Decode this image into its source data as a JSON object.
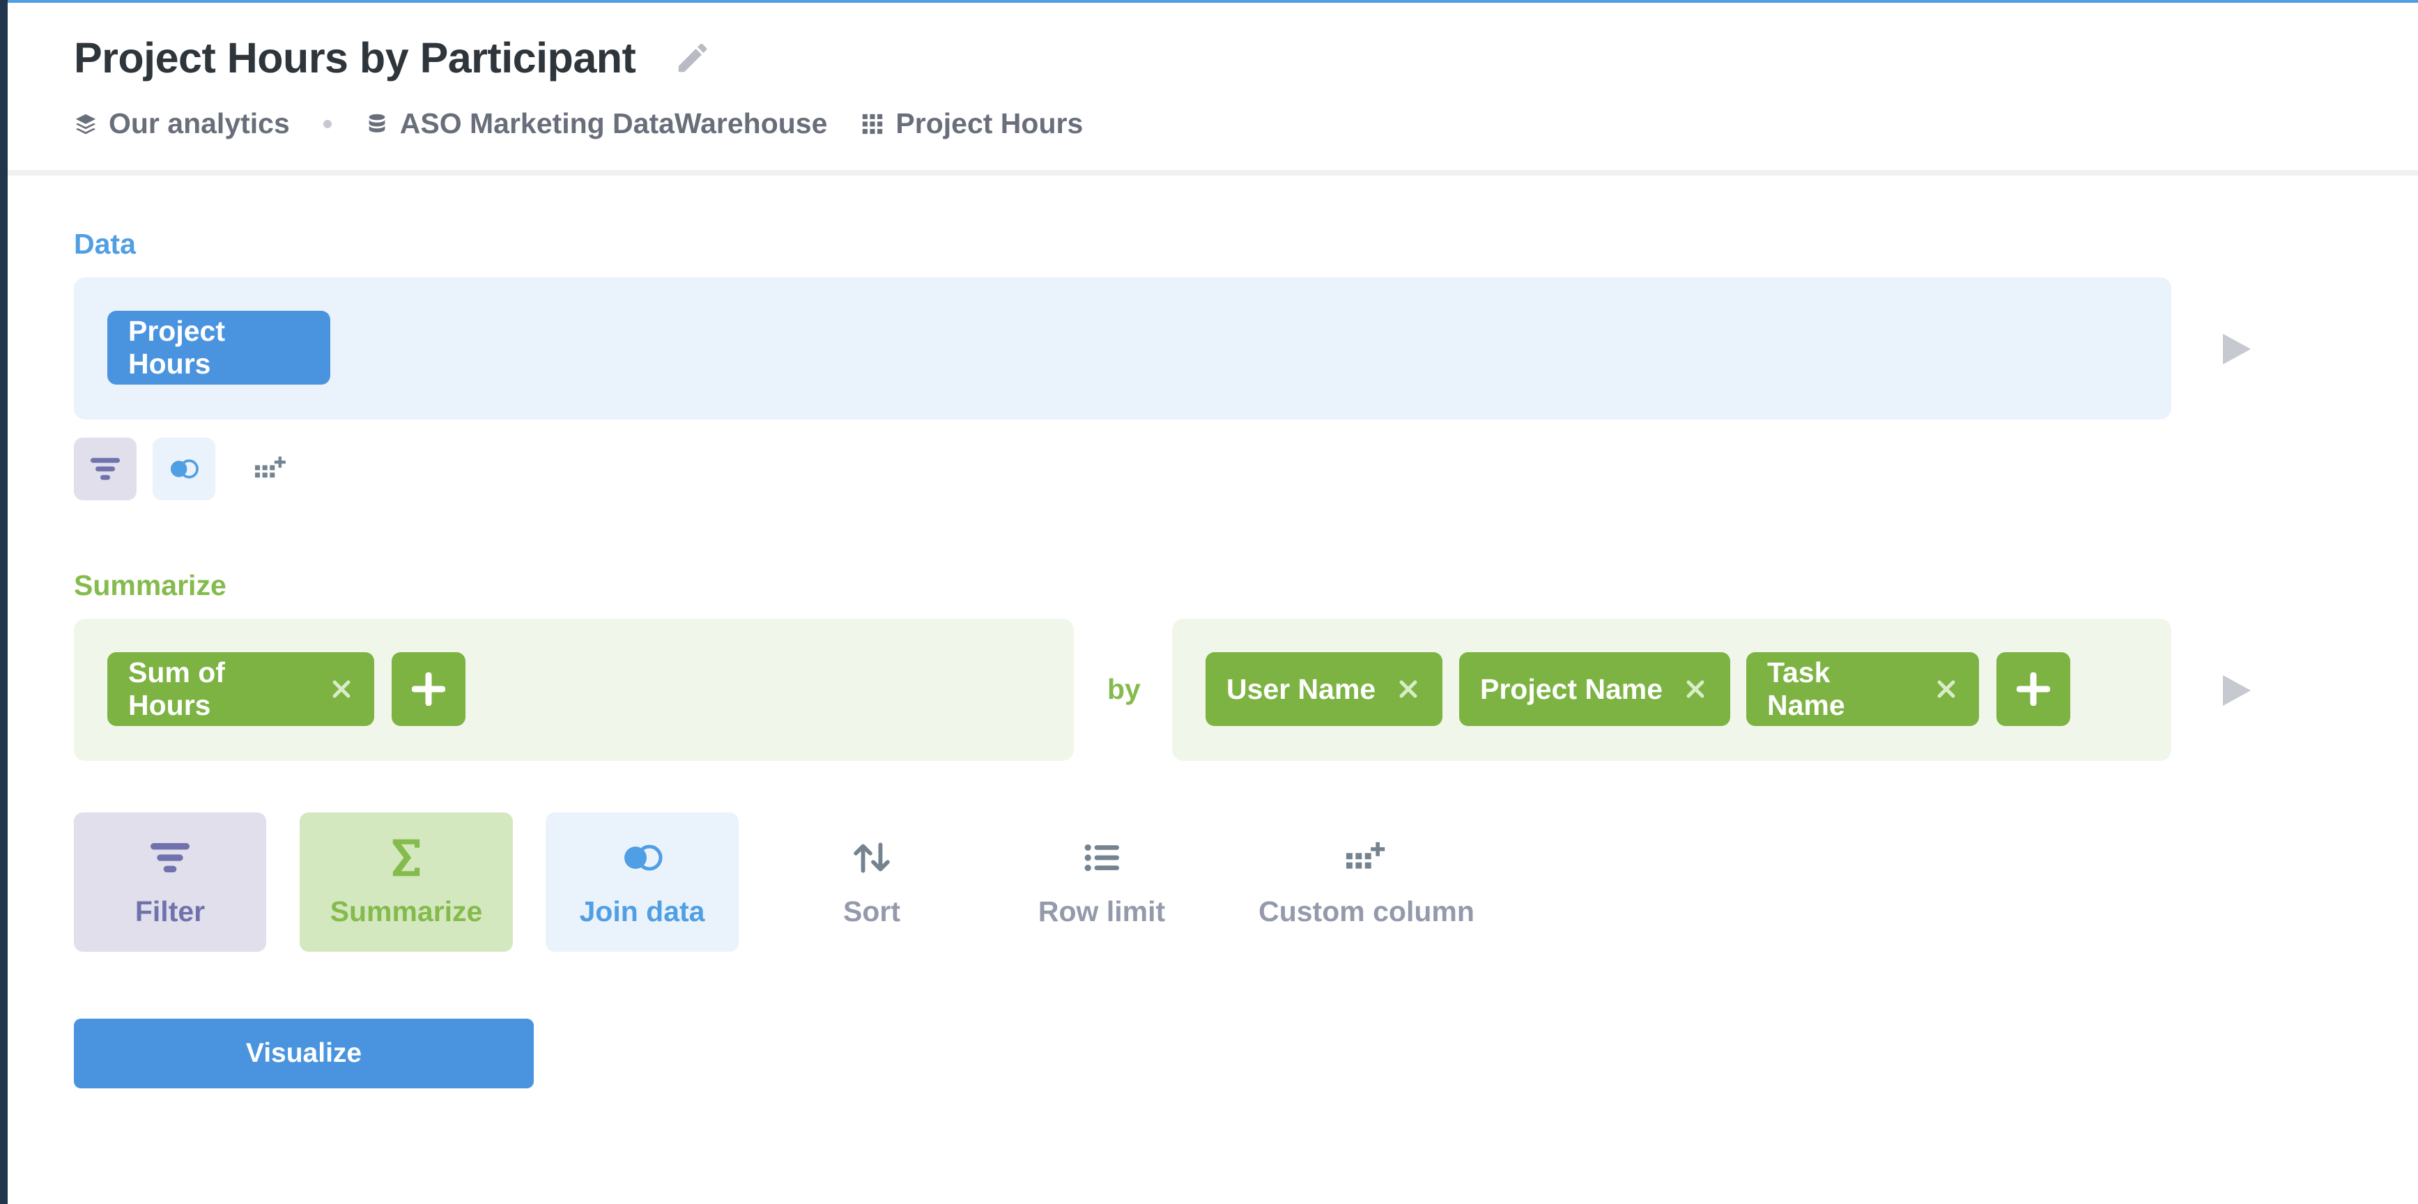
{
  "header": {
    "title": "Project Hours by Participant",
    "breadcrumb": [
      {
        "icon": "collection-icon",
        "label": "Our analytics"
      },
      {
        "icon": "database-icon",
        "label": "ASO Marketing DataWarehouse"
      },
      {
        "icon": "table-icon",
        "label": "Project Hours"
      }
    ]
  },
  "data_step": {
    "label": "Data",
    "table": "Project Hours"
  },
  "summarize_step": {
    "label": "Summarize",
    "metrics": [
      "Sum of Hours"
    ],
    "by_label": "by",
    "breakouts": [
      "User Name",
      "Project Name",
      "Task Name"
    ]
  },
  "actions": [
    {
      "label": "Filter",
      "icon": "filter-icon"
    },
    {
      "label": "Summarize",
      "icon": "sigma-icon"
    },
    {
      "label": "Join data",
      "icon": "join-icon"
    },
    {
      "label": "Sort",
      "icon": "sort-icon"
    },
    {
      "label": "Row limit",
      "icon": "list-icon"
    },
    {
      "label": "Custom column",
      "icon": "custom-column-icon"
    }
  ],
  "visualize_label": "Visualize",
  "colors": {
    "accent_blue": "#509ee3",
    "summarize_green": "#84bb4c",
    "filter_purple": "#7172ad"
  }
}
